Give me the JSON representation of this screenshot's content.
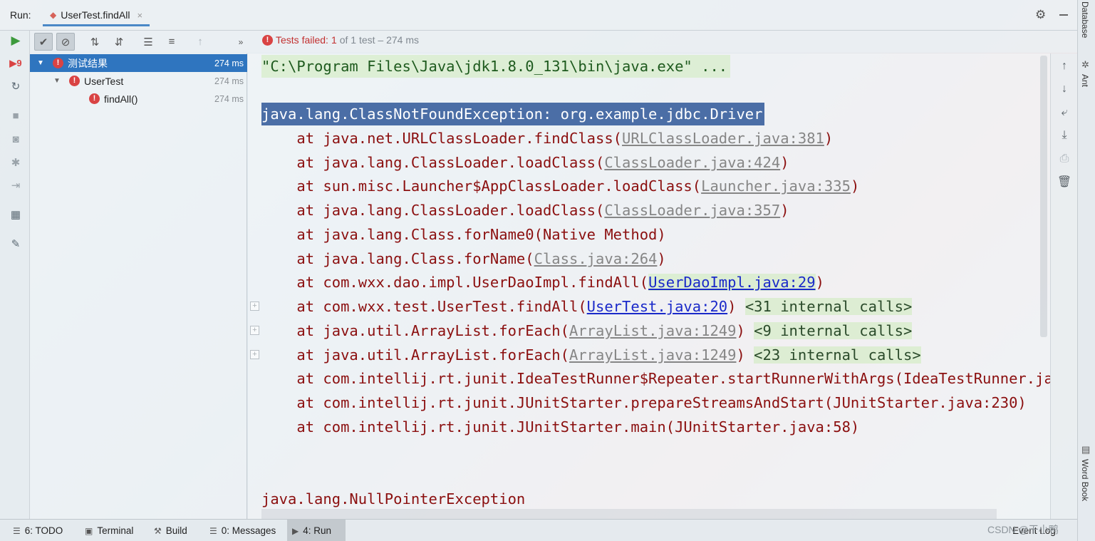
{
  "header": {
    "run_label": "Run:",
    "tab_title": "UserTest.findAll",
    "tab_close": "×"
  },
  "status": {
    "failed_label": "Tests failed:",
    "failed_count": "1",
    "of_text": "of 1 test – 274 ms"
  },
  "tree": {
    "items": [
      {
        "label": "测试结果",
        "time": "274 ms"
      },
      {
        "label": "UserTest",
        "time": "274 ms"
      },
      {
        "label": "findAll()",
        "time": "274 ms"
      }
    ]
  },
  "console": {
    "cmd": "\"C:\\Program Files\\Java\\jdk1.8.0_131\\bin\\java.exe\" ...",
    "exception1": "java.lang.ClassNotFoundException: org.example.jdbc.Driver",
    "frames": [
      {
        "pre": "    at java.net.URLClassLoader.findClass(",
        "link": "URLClassLoader.java:381",
        "post": ")"
      },
      {
        "pre": "    at java.lang.ClassLoader.loadClass(",
        "link": "ClassLoader.java:424",
        "post": ")"
      },
      {
        "pre": "    at sun.misc.Launcher$AppClassLoader.loadClass(",
        "link": "Launcher.java:335",
        "post": ")"
      },
      {
        "pre": "    at java.lang.ClassLoader.loadClass(",
        "link": "ClassLoader.java:357",
        "post": ")"
      },
      {
        "pre": "    at java.lang.Class.forName0(Native Method)",
        "link": "",
        "post": ""
      },
      {
        "pre": "    at java.lang.Class.forName(",
        "link": "Class.java:264",
        "post": ")"
      },
      {
        "pre": "    at com.wxx.dao.impl.UserDaoImpl.findAll(",
        "link": "UserDaoImpl.java:29",
        "post": ")"
      },
      {
        "pre": "    at com.wxx.test.UserTest.findAll(",
        "link": "UserTest.java:20",
        "post": ") ",
        "internal": "<31 internal calls>"
      },
      {
        "pre": "    at java.util.ArrayList.forEach(",
        "link": "ArrayList.java:1249",
        "post": ") ",
        "internal": "<9 internal calls>"
      },
      {
        "pre": "    at java.util.ArrayList.forEach(",
        "link": "ArrayList.java:1249",
        "post": ") ",
        "internal": "<23 internal calls>"
      },
      {
        "pre": "    at com.intellij.rt.junit.IdeaTestRunner$Repeater.startRunnerWithArgs(IdeaTestRunner.java",
        "link": "",
        "post": ""
      },
      {
        "pre": "    at com.intellij.rt.junit.JUnitStarter.prepareStreamsAndStart(JUnitStarter.java:230)",
        "link": "",
        "post": ""
      },
      {
        "pre": "    at com.intellij.rt.junit.JUnitStarter.main(JUnitStarter.java:58)",
        "link": "",
        "post": ""
      }
    ],
    "exception2": "java.lang.NullPointerException",
    "fold": "+"
  },
  "side_strip": {
    "database": "Database",
    "ant": "Ant",
    "word_book": "Word Book"
  },
  "bottom": {
    "todo": "6: TODO",
    "terminal": "Terminal",
    "build": "Build",
    "messages": "0: Messages",
    "run": "4: Run",
    "event_log": "Event Log"
  },
  "watermark": "CSDN @干小鸭",
  "colors": {
    "accent": "#2f75bf",
    "error": "#d94343",
    "exception_text": "#8b0f0f",
    "link": "#1a29c9"
  }
}
